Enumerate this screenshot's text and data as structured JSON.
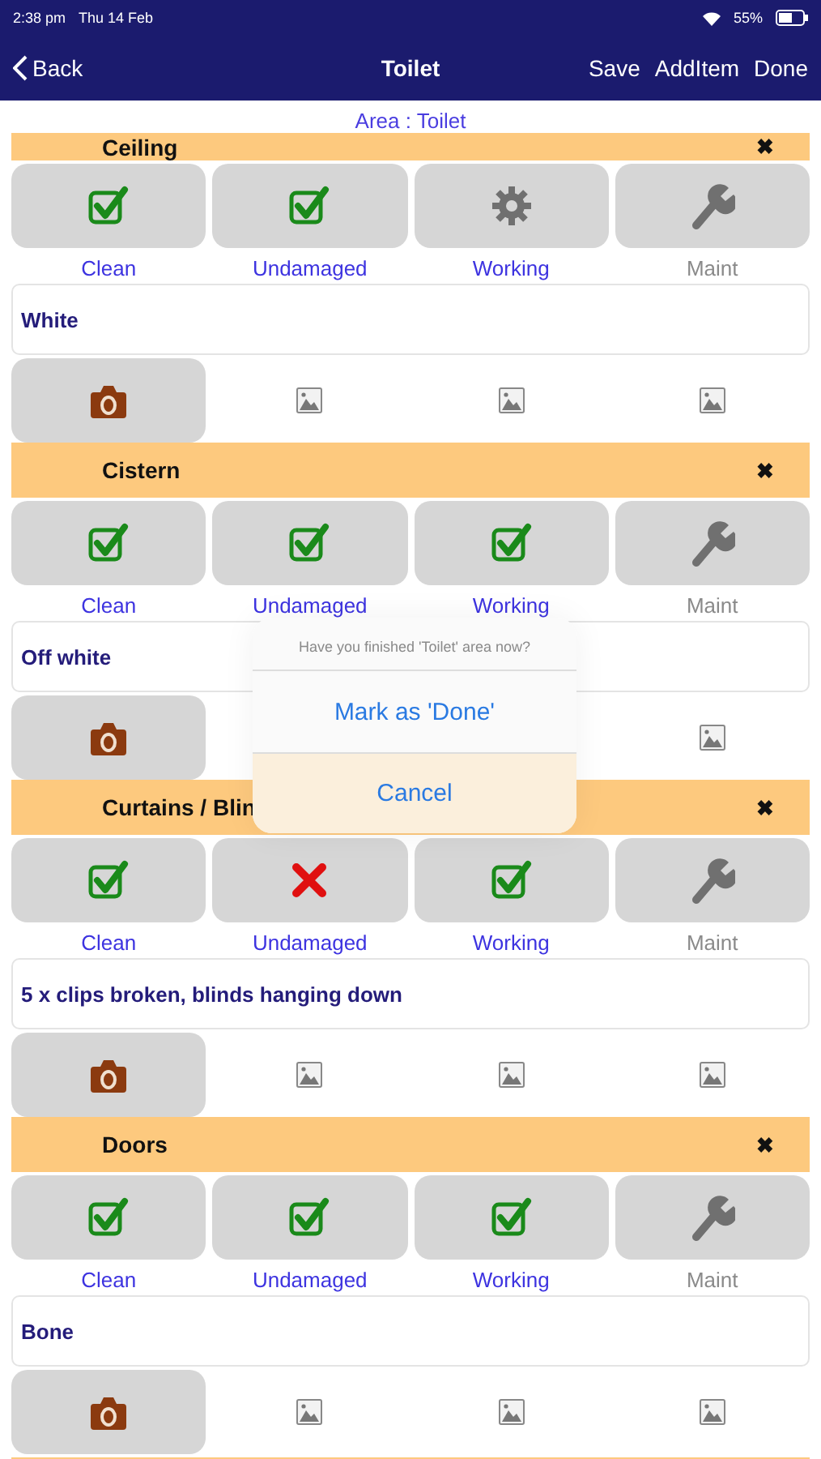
{
  "status_bar": {
    "time": "2:38 pm",
    "date": "Thu 14 Feb",
    "battery": "55%"
  },
  "nav": {
    "back": "Back",
    "title": "Toilet",
    "actions": [
      "Save",
      "AddItem",
      "Done"
    ]
  },
  "area_label": "Area : Toilet",
  "sections": [
    {
      "title": "Ceiling",
      "close": "✖",
      "note": "White",
      "checks": [
        {
          "label": "Clean",
          "kind": "check",
          "checked": true,
          "failed": false
        },
        {
          "label": "Undamaged",
          "kind": "check",
          "checked": true,
          "failed": false
        },
        {
          "label": "Working",
          "kind": "work",
          "checked": false,
          "failed": false
        },
        {
          "label": "Maint",
          "kind": "maint",
          "checked": false,
          "failed": false
        }
      ]
    },
    {
      "title": "Cistern",
      "close": "✖",
      "note": "Off white",
      "checks": [
        {
          "label": "Clean",
          "kind": "check",
          "checked": true,
          "failed": false
        },
        {
          "label": "Undamaged",
          "kind": "check",
          "checked": true,
          "failed": false
        },
        {
          "label": "Working",
          "kind": "work",
          "checked": true,
          "failed": false
        },
        {
          "label": "Maint",
          "kind": "maint",
          "checked": false,
          "failed": false
        }
      ]
    },
    {
      "title": "Curtains / Blin",
      "close": "✖",
      "note": "5 x clips broken, blinds hanging down",
      "checks": [
        {
          "label": "Clean",
          "kind": "check",
          "checked": true,
          "failed": false
        },
        {
          "label": "Undamaged",
          "kind": "check",
          "checked": false,
          "failed": true
        },
        {
          "label": "Working",
          "kind": "work",
          "checked": true,
          "failed": false
        },
        {
          "label": "Maint",
          "kind": "maint",
          "checked": false,
          "failed": false
        }
      ]
    },
    {
      "title": "Doors",
      "close": "✖",
      "note": "Bone",
      "checks": [
        {
          "label": "Clean",
          "kind": "check",
          "checked": true,
          "failed": false
        },
        {
          "label": "Undamaged",
          "kind": "check",
          "checked": true,
          "failed": false
        },
        {
          "label": "Working",
          "kind": "work",
          "checked": true,
          "failed": false
        },
        {
          "label": "Maint",
          "kind": "maint",
          "checked": false,
          "failed": false
        }
      ]
    }
  ],
  "dialog": {
    "message": "Have you finished 'Toilet' area now?",
    "buttons": [
      "Mark as 'Done'",
      "Cancel"
    ]
  }
}
